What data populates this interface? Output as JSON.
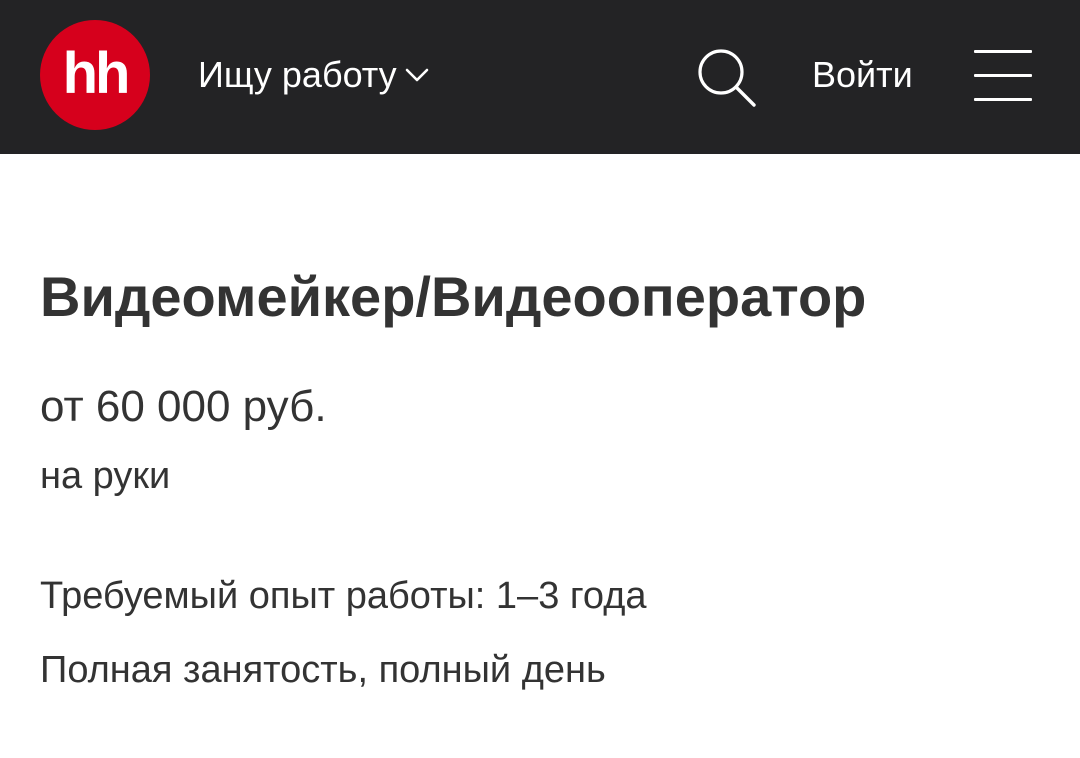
{
  "header": {
    "logo_text": "hh",
    "role_label": "Ищу работу",
    "role_icon": "chevron-down-icon",
    "search_icon": "search-icon",
    "login_label": "Войти",
    "menu_icon": "hamburger-menu-icon",
    "background_color": "#232325",
    "logo_color": "#d6001c"
  },
  "vacancy": {
    "title": "Видеомейкер/Видеооператор",
    "salary": "от 60 000 руб.",
    "salary_note": "на руки",
    "experience": "Требуемый опыт работы: 1–3 года",
    "employment": "Полная занятость, полный день"
  }
}
